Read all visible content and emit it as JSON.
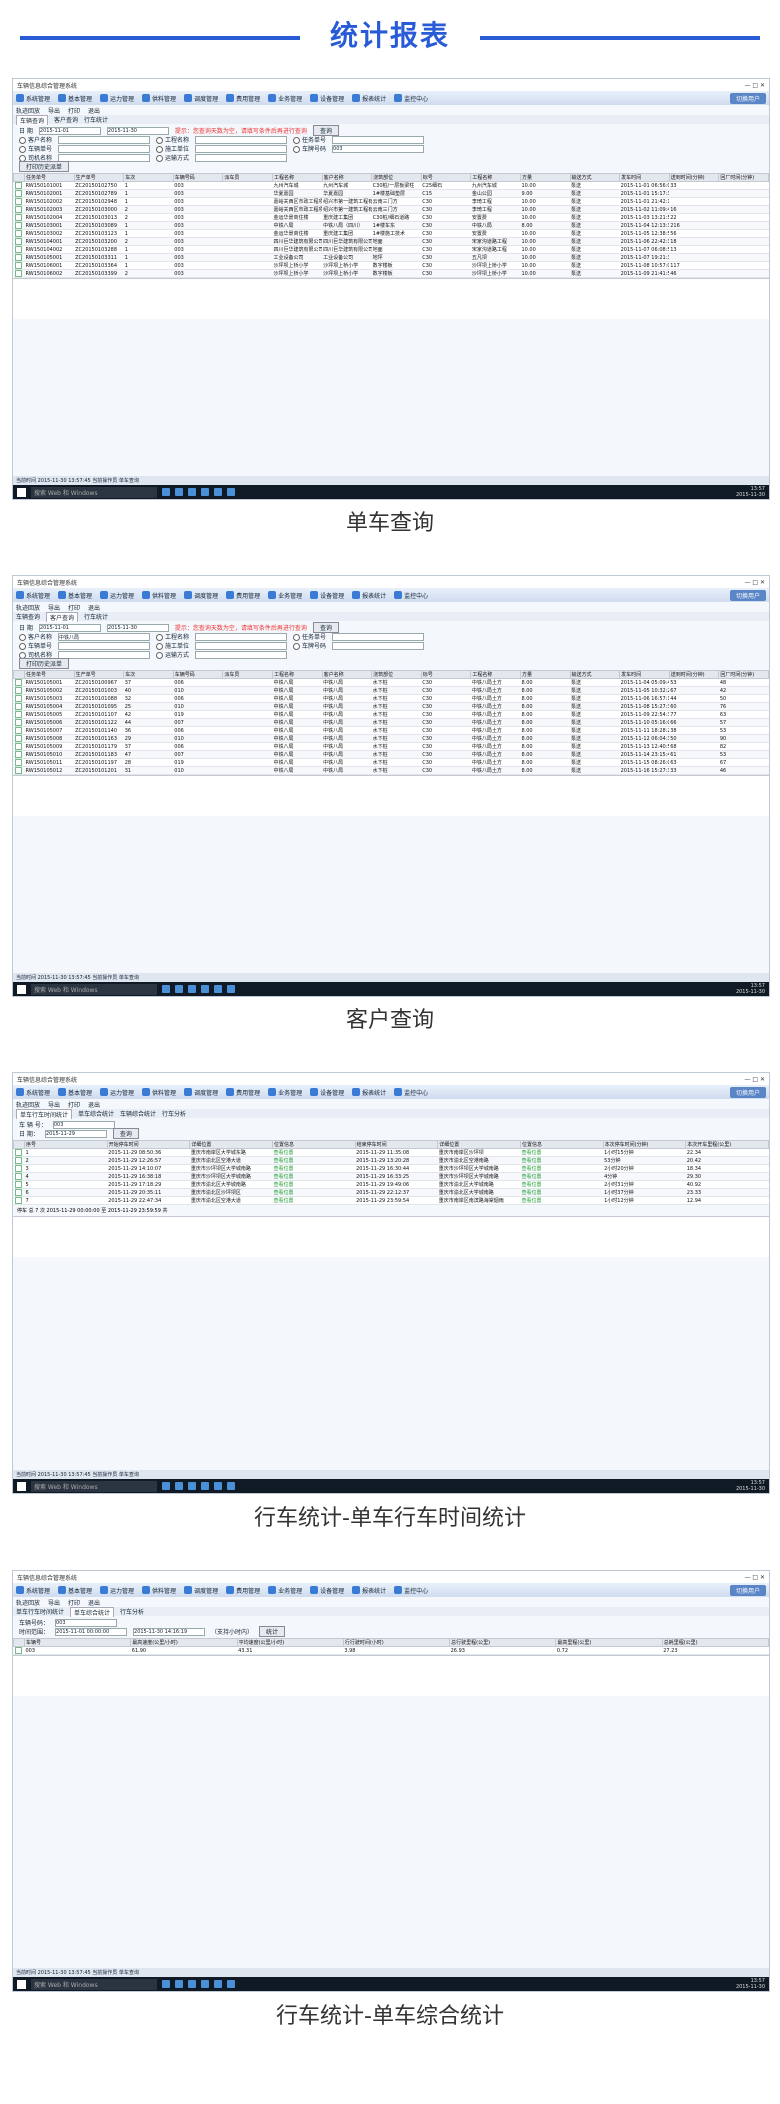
{
  "page": {
    "title": "统计报表"
  },
  "app": {
    "window_title": "车辆信息综合管理系统",
    "menus": [
      "系统管理",
      "基本管理",
      "运力管理",
      "供料管理",
      "调度管理",
      "费用管理",
      "业务管理",
      "设备管理",
      "报表统计",
      "监控中心"
    ],
    "login_label": "切换用户",
    "toolbar": [
      "轨迹回放",
      "导出",
      "打印",
      "退出"
    ],
    "footer_status": "当前时间 2015-11-30 13:57:45 当前操作员 单车查询",
    "tray_time": "13:57",
    "tray_date": "2015-11-30",
    "taskbar_search": "搜索 Web 和 Windows",
    "taskbar_app": "HMI-施工管理系统"
  },
  "screens": [
    {
      "caption": "单车查询",
      "tabs": [
        "车辆查询",
        "客户查询",
        "行车统计"
      ],
      "date_label": "日 期",
      "start_date": "2015-11-01",
      "end_date": "2015-11-30",
      "warning": "提示：您查询天数为空，请填写条件后再进行查询",
      "query_button": "查询",
      "radios": [
        "客户名称",
        "工程名称",
        "任务单号",
        "车辆单号",
        "施工单位",
        "车牌号码",
        "司机名称",
        "运输方式"
      ],
      "vehicle_value": "003",
      "export_button": "打印历史派单",
      "columns": [
        "任务单号",
        "生产单号",
        "车次",
        "车辆号码",
        "派车员",
        "工程名称",
        "客户名称",
        "浇筑部位",
        "标号",
        "工程名称",
        "方量",
        "输送方式",
        "发车时间",
        "送到时间(分钟)",
        "回厂时间(分钟)"
      ],
      "rows": [
        [
          "RW150101001",
          "ZC20150102750",
          "1",
          "003",
          "",
          "九州汽车城",
          "九州汽车城",
          "C30桩/一层板梁柱",
          "C25细石",
          "九州汽车城",
          "10.00",
          "泵送",
          "2015-11-01 06:56:01",
          "33",
          ""
        ],
        [
          "RW150102001",
          "ZC20150102789",
          "1",
          "003",
          "",
          "华夏嘉园",
          "华夏嘉园",
          "1#楼基础垫层",
          "C15",
          "金山公园",
          "9.00",
          "泵送",
          "2015-11-01 15:17:38",
          "",
          ""
        ],
        [
          "RW150102002",
          "ZC20150102948",
          "1",
          "003",
          "",
          "嘉峪关西区市政工程项目",
          "绍兴市第一建筑工程有限公司",
          "云南三门方",
          "C30",
          "李琦工程",
          "10.00",
          "泵送",
          "2015-11-01 21:42:17",
          "",
          ""
        ],
        [
          "RW150102003",
          "ZC20150103000",
          "2",
          "003",
          "",
          "嘉峪关西区市政工程项目",
          "绍兴市第一建筑工程有限公司",
          "云南三门方",
          "C30",
          "李琦工程",
          "10.00",
          "泵送",
          "2015-11-02 11:09:40",
          "16",
          ""
        ],
        [
          "RW150102004",
          "ZC20150103013",
          "2",
          "003",
          "",
          "金运华景商住楼",
          "重庆建工集团",
          "C30桩/细石道路",
          "C30",
          "安置费",
          "10.00",
          "泵送",
          "2015-11-03 13:21:56",
          "22",
          ""
        ],
        [
          "RW150103001",
          "ZC20150103089",
          "1",
          "003",
          "",
          "中铁八局",
          "中铁八局（四川）",
          "1#楼车东",
          "C30",
          "中铁八局",
          "8.00",
          "泵送",
          "2015-11-04 12:13:36",
          "216",
          ""
        ],
        [
          "RW150103002",
          "ZC20150103123",
          "1",
          "003",
          "",
          "金运华景商住楼",
          "重庆建工集团",
          "1#楼施工技术",
          "C30",
          "安置费",
          "10.00",
          "泵送",
          "2015-11-05 12:38:52",
          "56",
          ""
        ],
        [
          "RW150104001",
          "ZC20150103200",
          "2",
          "003",
          "",
          "四川巨华建筑有限公司",
          "四川巨华建筑有限公司",
          "地面",
          "C30",
          "宋家沟道路工程",
          "10.00",
          "泵送",
          "2015-11-06 22:42:30",
          "18",
          ""
        ],
        [
          "RW150104002",
          "ZC20150103288",
          "1",
          "003",
          "",
          "四川巨华建筑有限公司",
          "四川巨华建筑有限公司",
          "地面",
          "C30",
          "宋家沟道路工程",
          "10.00",
          "泵送",
          "2015-11-07 06:08:56",
          "13",
          ""
        ],
        [
          "RW150105001",
          "ZC20150103311",
          "1",
          "003",
          "",
          "工业设备公司",
          "工业设备公司",
          "地坪",
          "C30",
          "五凡坝",
          "10.00",
          "泵送",
          "2015-11-07 19:21:34",
          "",
          ""
        ],
        [
          "RW150106001",
          "ZC20150103364",
          "1",
          "003",
          "",
          "沙坪坝上桥小学",
          "沙坪坝上桥小学",
          "数字楼板",
          "C30",
          "沙坪坝上桥小学",
          "10.00",
          "泵送",
          "2015-11-08 10:57:02",
          "117",
          ""
        ],
        [
          "RW150106002",
          "ZC20150103399",
          "2",
          "003",
          "",
          "沙坪坝上桥小学",
          "沙坪坝上桥小学",
          "数字楼板",
          "C30",
          "沙坪坝上桥小学",
          "10.00",
          "泵送",
          "2015-11-09 21:41:54",
          "46",
          ""
        ]
      ]
    },
    {
      "caption": "客户查询",
      "tabs": [
        "车辆查询",
        "客户查询",
        "行车统计"
      ],
      "customer_value": "中铁八局",
      "columns": [
        "任务单号",
        "生产单号",
        "车次",
        "车辆号码",
        "派车员",
        "工程名称",
        "客户名称",
        "浇筑部位",
        "标号",
        "工程名称",
        "方量",
        "输送方式",
        "发车时间",
        "送到时间(分钟)",
        "回厂时间(分钟)"
      ],
      "rows": [
        [
          "RW150105001",
          "ZC20150100967",
          "37",
          "006",
          "",
          "中铁八局",
          "中铁八局",
          "水下桩",
          "C30",
          "中铁八局土方",
          "8.00",
          "泵送",
          "2015-11-04 05:09:46",
          "53",
          "48"
        ],
        [
          "RW150105002",
          "ZC20150101003",
          "40",
          "010",
          "",
          "中铁八局",
          "中铁八局",
          "水下桩",
          "C30",
          "中铁八局土方",
          "8.00",
          "泵送",
          "2015-11-05 10:32:21",
          "67",
          "42"
        ],
        [
          "RW150105003",
          "ZC20150101088",
          "32",
          "006",
          "",
          "中铁八局",
          "中铁八局",
          "水下桩",
          "C30",
          "中铁八局土方",
          "8.00",
          "泵送",
          "2015-11-06 16:57:11",
          "44",
          "50"
        ],
        [
          "RW150105004",
          "ZC20150101095",
          "25",
          "010",
          "",
          "中铁八局",
          "中铁八局",
          "水下桩",
          "C30",
          "中铁八局土方",
          "8.00",
          "泵送",
          "2015-11-08 15:27:35",
          "60",
          "76"
        ],
        [
          "RW150105005",
          "ZC20150101107",
          "42",
          "019",
          "",
          "中铁八局",
          "中铁八局",
          "水下桩",
          "C30",
          "中铁八局土方",
          "8.00",
          "泵送",
          "2015-11-09 22:54:36",
          "77",
          "63"
        ],
        [
          "RW150105006",
          "ZC20150101122",
          "44",
          "007",
          "",
          "中铁八局",
          "中铁八局",
          "水下桩",
          "C30",
          "中铁八局土方",
          "8.00",
          "泵送",
          "2015-11-10 05:16:04",
          "66",
          "57"
        ],
        [
          "RW150105007",
          "ZC20150101140",
          "36",
          "006",
          "",
          "中铁八局",
          "中铁八局",
          "水下桩",
          "C30",
          "中铁八局土方",
          "8.00",
          "泵送",
          "2015-11-11 18:28:26",
          "38",
          "53"
        ],
        [
          "RW150105008",
          "ZC20150101163",
          "29",
          "010",
          "",
          "中铁八局",
          "中铁八局",
          "水下桩",
          "C30",
          "中铁八局土方",
          "8.00",
          "泵送",
          "2015-11-12 06:04:33",
          "50",
          "90"
        ],
        [
          "RW150105009",
          "ZC20150101179",
          "37",
          "006",
          "",
          "中铁八局",
          "中铁八局",
          "水下桩",
          "C30",
          "中铁八局土方",
          "8.00",
          "泵送",
          "2015-11-13 12:40:55",
          "68",
          "82"
        ],
        [
          "RW150105010",
          "ZC20150101183",
          "47",
          "007",
          "",
          "中铁八局",
          "中铁八局",
          "水下桩",
          "C30",
          "中铁八局土方",
          "8.00",
          "泵送",
          "2015-11-14 23:15:43",
          "61",
          "53"
        ],
        [
          "RW150105011",
          "ZC20150101197",
          "28",
          "019",
          "",
          "中铁八局",
          "中铁八局",
          "水下桩",
          "C30",
          "中铁八局土方",
          "8.00",
          "泵送",
          "2015-11-15 08:26:00",
          "63",
          "67"
        ],
        [
          "RW150105012",
          "ZC20150101201",
          "31",
          "010",
          "",
          "中铁八局",
          "中铁八局",
          "水下桩",
          "C30",
          "中铁八局土方",
          "8.00",
          "泵送",
          "2015-11-16 15:27:31",
          "33",
          "46"
        ]
      ]
    },
    {
      "caption": "行车统计-单车行车时间统计",
      "tabs": [
        "单车行车时间统计",
        "单车综合统计",
        "车辆综合统计",
        "行车分析"
      ],
      "vehicle_label": "车 辆 号：",
      "vehicle_value": "003",
      "date_label": "日 期：",
      "date_value": "2015-11-29",
      "query_button": "查询",
      "columns": [
        "序号",
        "开始停车时间",
        "详细位置",
        "位置信息",
        "结束停车时间",
        "详细位置",
        "位置信息",
        "本次停车时间(分钟)",
        "本次开车里程(公里)"
      ],
      "rows": [
        [
          "1",
          "2015-11-29 08:50:36",
          "重庆市南岸区大学城东路",
          "查看位置",
          "2015-11-29 11:35:08",
          "重庆市南岸区沙坪坝",
          "查看位置",
          "1小时15分钟",
          "22.34"
        ],
        [
          "2",
          "2015-11-29 12:26:57",
          "重庆市渝北区空港大道",
          "查看位置",
          "2015-11-29 13:20:28",
          "重庆市渝北区空港南路",
          "查看位置",
          "53分钟",
          "20.42"
        ],
        [
          "3",
          "2015-11-29 14:10:07",
          "重庆市沙坪坝区大学城南路",
          "查看位置",
          "2015-11-29 16:30:44",
          "重庆市沙坪坝区大学城南路",
          "查看位置",
          "2小时20分钟",
          "18.34"
        ],
        [
          "4",
          "2015-11-29 16:38:18",
          "重庆市沙坪坝区大学城南路",
          "查看位置",
          "2015-11-29 16:33:25",
          "重庆市沙坪坝区大学城南路",
          "查看位置",
          "4分钟",
          "29.30"
        ],
        [
          "5",
          "2015-11-29 17:18:29",
          "重庆市渝北区大学城南路",
          "查看位置",
          "2015-11-29 19:49:06",
          "重庆市渝北区大学城南路",
          "查看位置",
          "2小时31分钟",
          "40.92"
        ],
        [
          "6",
          "2015-11-29 20:35:11",
          "重庆市渝北区沙坪坝区",
          "查看位置",
          "2015-11-29 22:12:37",
          "重庆市渝北区大学城南路",
          "查看位置",
          "1小时37分钟",
          "23.33"
        ],
        [
          "7",
          "2015-11-29 22:47:34",
          "重庆市渝北区空港大道",
          "查看位置",
          "2015-11-29 23:59:54",
          "重庆市南岸区南滨路海棠烟雨",
          "查看位置",
          "1小时12分钟",
          "12.94"
        ]
      ],
      "summary": "停车 总 7 次 2015-11-29 00:00:00 至 2015-11-29 23:59:59 共"
    },
    {
      "caption": "行车统计-单车综合统计",
      "tabs": [
        "单车行车时间统计",
        "单车综合统计",
        "行车分析"
      ],
      "vehicle_label": "车辆号码：",
      "vehicle_value": "003",
      "time_label": "时间范围：",
      "start_value": "2015-11-01 00:00:00",
      "end_value": "2015-11-30 14:16:19",
      "note": "（支持小时内）",
      "query_button": "统计",
      "columns": [
        "车辆号",
        "最高速度(公里/小时)",
        "平均速度(公里/小时)",
        "行行驶时间(小时)",
        "总行驶里程(公里)",
        "最高里程(公里)",
        "总耗里程(公里)"
      ],
      "rows": [
        [
          "003",
          "61.90",
          "43.31",
          "3.98",
          "26.93",
          "0.72",
          "27.23"
        ]
      ]
    }
  ]
}
